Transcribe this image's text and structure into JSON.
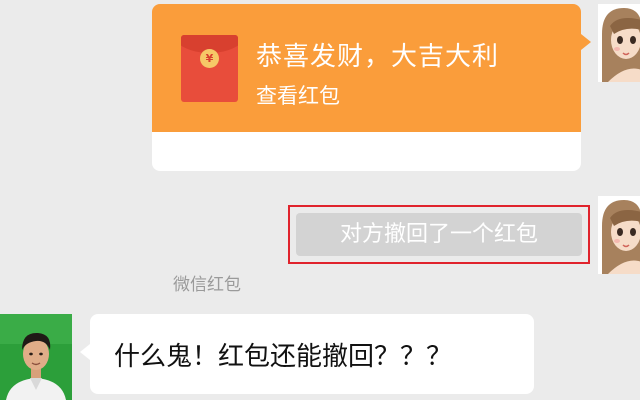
{
  "red_packet": {
    "title": "恭喜发财，大吉大利",
    "subtitle": "查看红包",
    "footer": "微信红包",
    "coin_glyph": "¥",
    "accent_color": "#fa9d3b",
    "envelope_color": "#e84d3b"
  },
  "notice": {
    "text": "对方撤回了一个红包",
    "highlight_color": "#e0232c"
  },
  "incoming_message": {
    "text": "什么鬼！红包还能撤回？？？"
  },
  "avatars": {
    "sender": "avatar-woman-cartoon",
    "receiver": "avatar-man-photo"
  }
}
